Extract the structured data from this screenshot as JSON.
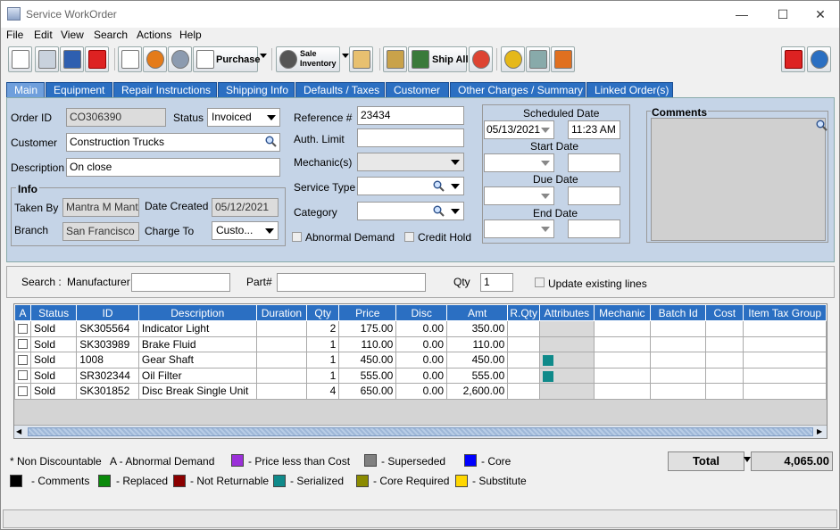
{
  "window": {
    "title": "Service WorkOrder",
    "minimize": "—",
    "maximize": "☐",
    "close": "✕"
  },
  "menu": [
    "File",
    "Edit",
    "View",
    "Search",
    "Actions",
    "Help"
  ],
  "toolbar": {
    "purchase": "Purchase",
    "sale_inventory_1": "Sale",
    "sale_inventory_2": "Inventory",
    "ship_all": "Ship All"
  },
  "tabs": [
    "Main",
    "Equipment",
    "Repair Instructions",
    "Shipping Info",
    "Defaults / Taxes",
    "Customer",
    "Other Charges / Summary",
    "Linked Order(s)"
  ],
  "main": {
    "order_id_label": "Order ID",
    "order_id": "CO306390",
    "status_label": "Status",
    "status": "Invoiced",
    "customer_label": "Customer",
    "customer": "Construction Trucks",
    "description_label": "Description",
    "description": "On close",
    "info_label": "Info",
    "taken_by_label": "Taken By",
    "taken_by": "Mantra M Mantra",
    "date_created_label": "Date Created",
    "date_created": "05/12/2021",
    "branch_label": "Branch",
    "branch": "San Francisco",
    "charge_to_label": "Charge To",
    "charge_to": "Custo...",
    "reference_label": "Reference #",
    "reference": "23434",
    "auth_limit_label": "Auth. Limit",
    "auth_limit": "",
    "mechanics_label": "Mechanic(s)",
    "service_type_label": "Service Type",
    "category_label": "Category",
    "abnormal_demand_label": "Abnormal Demand",
    "credit_hold_label": "Credit Hold",
    "scheduled_date_label": "Scheduled Date",
    "scheduled_date": "05/13/2021",
    "scheduled_time": "11:23 AM",
    "start_date_label": "Start Date",
    "due_date_label": "Due Date",
    "end_date_label": "End Date",
    "comments_label": "Comments"
  },
  "search": {
    "search_label": "Search :",
    "manufacturer_label": "Manufacturer",
    "part_label": "Part#",
    "qty_label": "Qty",
    "qty": "1",
    "update_label": "Update existing lines"
  },
  "grid": {
    "headers": [
      "A",
      "Status",
      "ID",
      "Description",
      "Duration",
      "Qty",
      "Price",
      "Disc",
      "Amt",
      "R.Qty",
      "Attributes",
      "Mechanic",
      "Batch Id",
      "Cost",
      "Item Tax Group"
    ],
    "rows": [
      {
        "status": "Sold",
        "id": "SK305564",
        "description": "Indicator Light",
        "qty": "2",
        "price": "175.00",
        "disc": "0.00",
        "amt": "350.00",
        "attr": false
      },
      {
        "status": "Sold",
        "id": "SK303989",
        "description": "Brake Fluid",
        "qty": "1",
        "price": "110.00",
        "disc": "0.00",
        "amt": "110.00",
        "attr": false
      },
      {
        "status": "Sold",
        "id": "1008",
        "description": "Gear Shaft",
        "qty": "1",
        "price": "450.00",
        "disc": "0.00",
        "amt": "450.00",
        "attr": true
      },
      {
        "status": "Sold",
        "id": "SR302344",
        "description": "Oil Filter",
        "qty": "1",
        "price": "555.00",
        "disc": "0.00",
        "amt": "555.00",
        "attr": true
      },
      {
        "status": "Sold",
        "id": "SK301852",
        "description": "Disc Break Single Unit",
        "qty": "4",
        "price": "650.00",
        "disc": "0.00",
        "amt": "2,600.00",
        "attr": false
      }
    ]
  },
  "legend": {
    "non_discountable": "* Non Discountable",
    "abnormal": "A - Abnormal Demand",
    "items": [
      {
        "label": "- Price less than Cost",
        "color": "#9b30d9"
      },
      {
        "label": "- Superseded",
        "color": "#808080"
      },
      {
        "label": "- Core",
        "color": "#0000ff"
      },
      {
        "label": "- Comments",
        "color": "#000000"
      },
      {
        "label": "- Replaced",
        "color": "#0a8a0a"
      },
      {
        "label": "- Not Returnable",
        "color": "#8b0000"
      },
      {
        "label": "- Serialized",
        "color": "#0f8a8a"
      },
      {
        "label": "- Core Required",
        "color": "#8b8b00"
      },
      {
        "label": "- Substitute",
        "color": "#ffd700"
      }
    ],
    "total_label": "Total",
    "total": "4,065.00"
  }
}
